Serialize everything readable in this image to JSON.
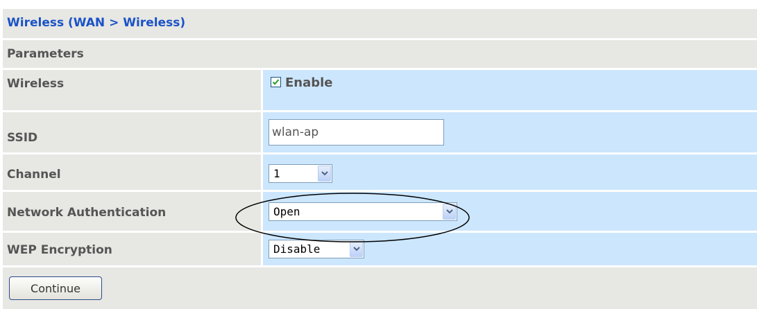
{
  "header": {
    "title": "Wireless (WAN > Wireless)",
    "title_color": "#1a52c7"
  },
  "section": {
    "title": "Parameters"
  },
  "fields": {
    "wireless": {
      "label": "Wireless",
      "checkbox_checked": true,
      "checkbox_label": "Enable"
    },
    "ssid": {
      "label": "SSID",
      "value": "wlan-ap"
    },
    "channel": {
      "label": "Channel",
      "selected": "1"
    },
    "network_auth": {
      "label": "Network Authentication",
      "selected": "Open"
    },
    "wep": {
      "label": "WEP Encryption",
      "selected": "Disable"
    }
  },
  "actions": {
    "continue_label": "Continue"
  },
  "colors": {
    "label_background": "#e7e7e3",
    "value_background": "#cce6fd",
    "label_text": "#555555"
  },
  "icons": {
    "checkbox": "check-icon",
    "select_arrow": "chevron-down-icon",
    "highlight": "ellipse-annotation"
  }
}
